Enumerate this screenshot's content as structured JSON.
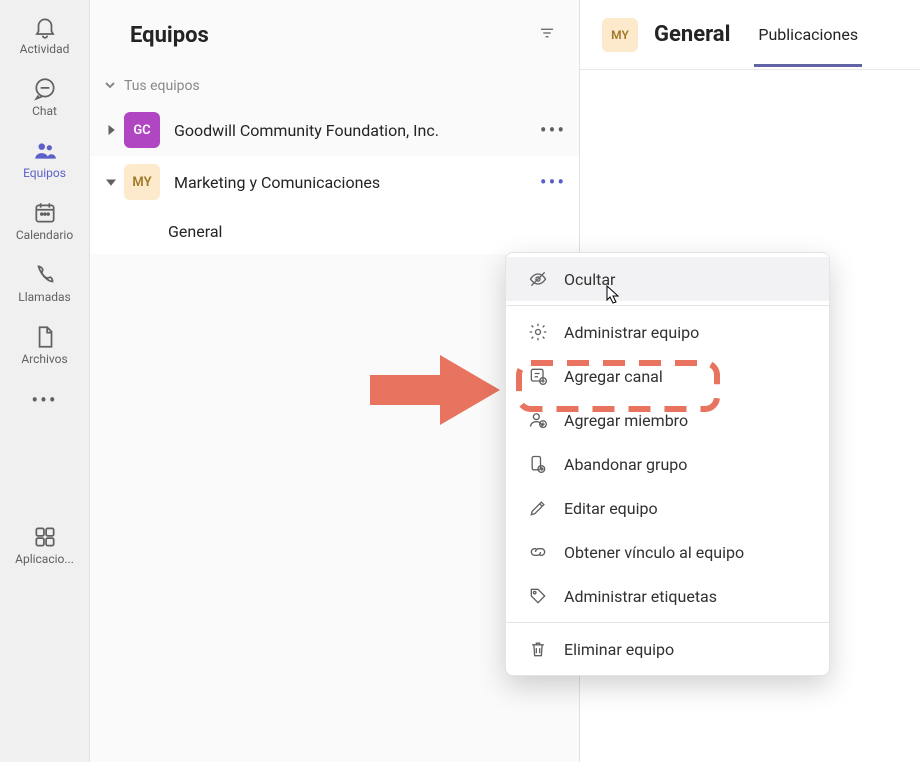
{
  "rail": {
    "items": [
      {
        "label": "Actividad"
      },
      {
        "label": "Chat"
      },
      {
        "label": "Equipos"
      },
      {
        "label": "Calendario"
      },
      {
        "label": "Llamadas"
      },
      {
        "label": "Archivos"
      }
    ],
    "apps_label": "Aplicacio..."
  },
  "mid": {
    "title": "Equipos",
    "section_label": "Tus equipos",
    "teams": [
      {
        "abbrev": "GC",
        "name": "Goodwill Community Foundation, Inc."
      },
      {
        "abbrev": "MY",
        "name": "Marketing y Comunicaciones"
      }
    ],
    "channel": "General"
  },
  "right": {
    "team_abbrev": "MY",
    "title": "General",
    "tab": "Publicaciones"
  },
  "menu": {
    "hide": "Ocultar",
    "manage": "Administrar equipo",
    "add_channel": "Agregar canal",
    "add_member": "Agregar miembro",
    "leave": "Abandonar grupo",
    "edit": "Editar equipo",
    "link": "Obtener vínculo al equipo",
    "tags": "Administrar etiquetas",
    "delete": "Eliminar equipo"
  }
}
